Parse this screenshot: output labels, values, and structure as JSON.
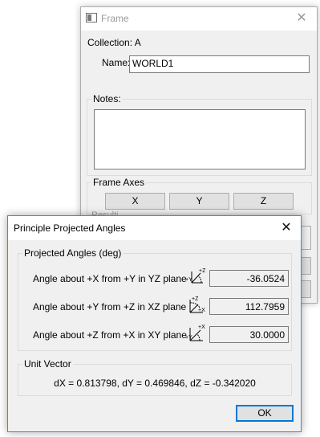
{
  "frame_window": {
    "title": "Frame",
    "collection": "Collection: A",
    "name_label": "Name:",
    "name_value": "WORLD1",
    "notes_label": "Notes:",
    "frame_axes_label": "Frame Axes",
    "axes_buttons": [
      "X",
      "Y",
      "Z"
    ],
    "partial_label": "Resulti"
  },
  "dialog": {
    "title": "Principle Projected Angles",
    "projected_group_label": "Projected Angles (deg)",
    "rows": [
      {
        "label": "Angle about +X from +Y in YZ plane",
        "value": "-36.0524",
        "icon": "yz-plane-icon"
      },
      {
        "label": "Angle about +Y from +Z in XZ plane",
        "value": "112.7959",
        "icon": "xz-plane-icon"
      },
      {
        "label": "Angle about +Z from +X in XY plane",
        "value": "30.0000",
        "icon": "xy-plane-icon"
      }
    ],
    "unit_vector_label": "Unit Vector",
    "unit_vector_text": "dX = 0.813798,  dY = 0.469846,  dZ = -0.342020",
    "ok_label": "OK"
  }
}
